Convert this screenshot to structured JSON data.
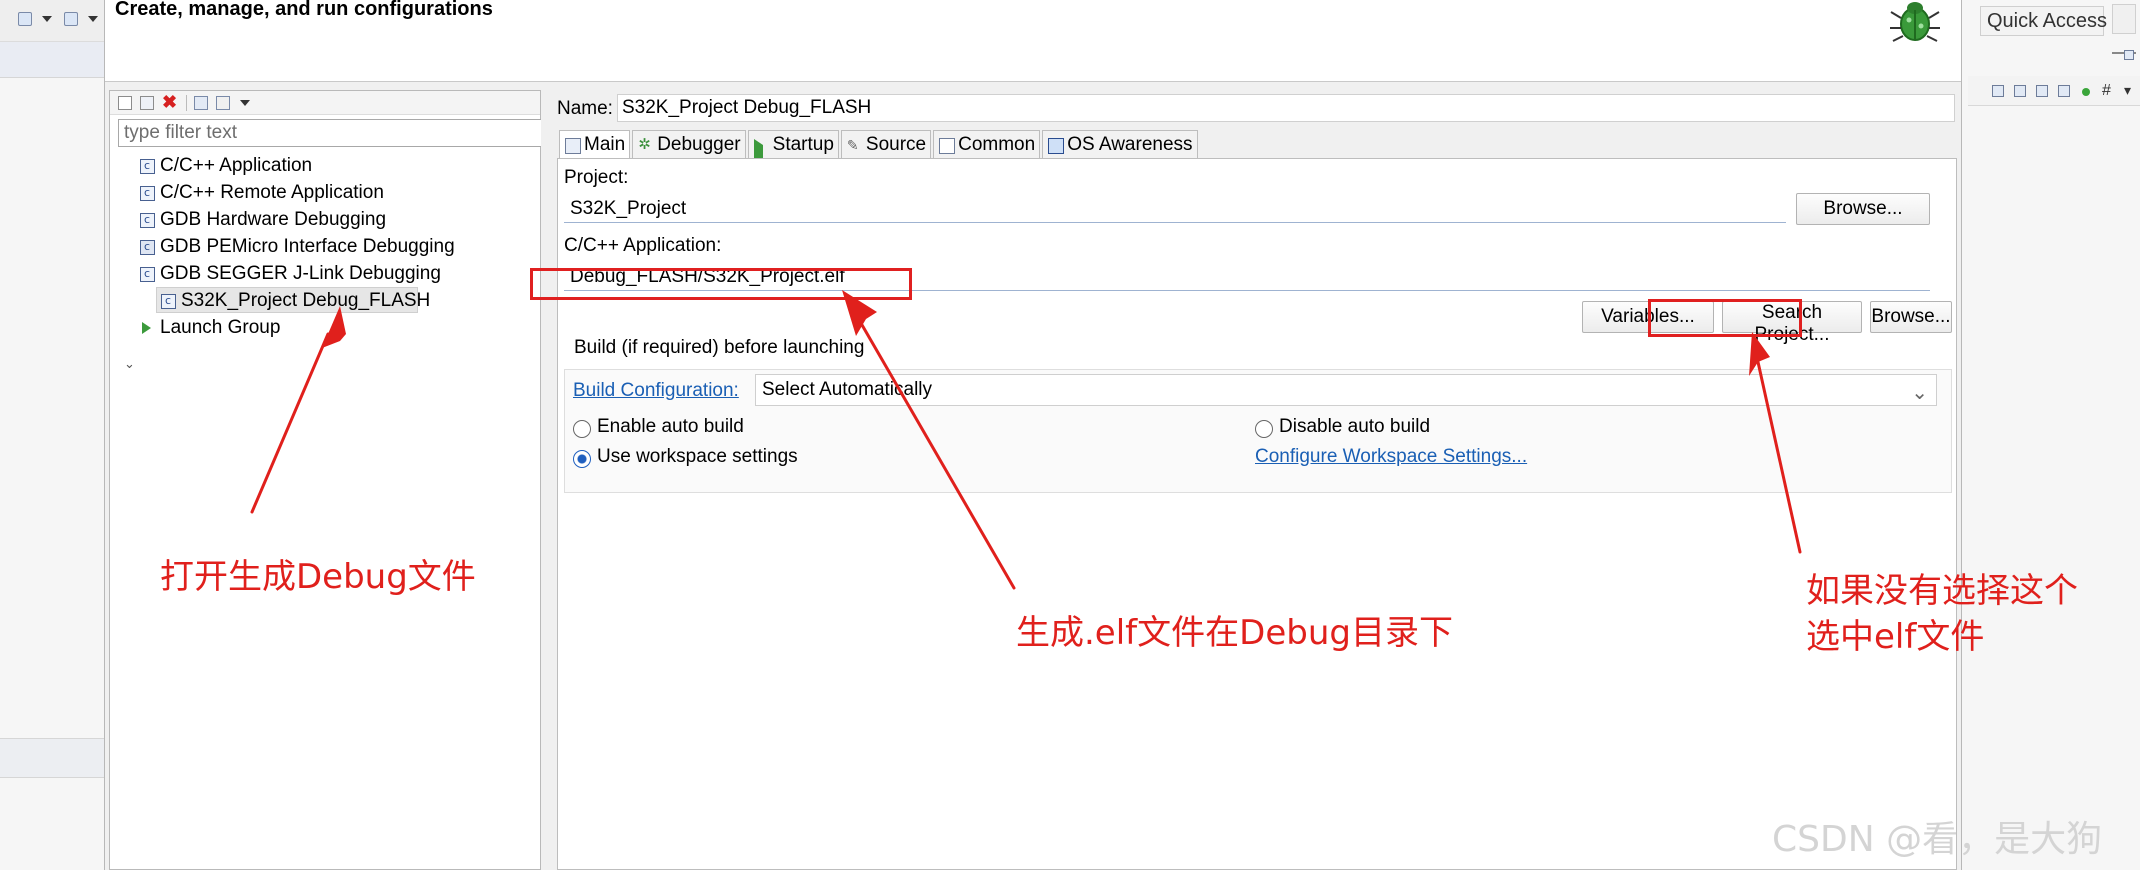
{
  "dialog": {
    "title": "Create, manage, and run configurations"
  },
  "left_pane": {
    "filter_placeholder": "type filter text",
    "tree": [
      {
        "label": "C/C++ Application"
      },
      {
        "label": "C/C++ Remote Application"
      },
      {
        "label": "GDB Hardware Debugging"
      },
      {
        "label": "GDB PEMicro Interface Debugging"
      },
      {
        "label": "GDB SEGGER J-Link Debugging"
      },
      {
        "label": "S32K_Project Debug_FLASH"
      },
      {
        "label": "Launch Group"
      }
    ]
  },
  "right_pane": {
    "name_label": "Name:",
    "name_value": "S32K_Project Debug_FLASH",
    "tabs": [
      {
        "label": "Main"
      },
      {
        "label": "Debugger"
      },
      {
        "label": "Startup"
      },
      {
        "label": "Source"
      },
      {
        "label": "Common"
      },
      {
        "label": "OS Awareness"
      }
    ],
    "project_label": "Project:",
    "project_value": "S32K_Project",
    "browse_label": "Browse...",
    "app_label": "C/C++ Application:",
    "app_value": "Debug_FLASH/S32K_Project.elf",
    "variables_label": "Variables...",
    "search_project_label": "Search Project...",
    "build": {
      "heading": "Build (if required) before launching",
      "config_link": "Build Configuration:",
      "config_value": "Select Automatically",
      "enable_auto": "Enable auto build",
      "disable_auto": "Disable auto build",
      "use_workspace": "Use workspace settings",
      "configure_link": "Configure Workspace Settings..."
    }
  },
  "right_side": {
    "quick_access": "Quick Access"
  },
  "annotations": {
    "note_debug": "打开生成Debug文件",
    "note_elf": "生成.elf文件在Debug目录下",
    "note_select_1": "如果没有选择这个",
    "note_select_2": "选中elf文件",
    "color": "#e0201c"
  },
  "watermark": "CSDN @看，是大狗"
}
